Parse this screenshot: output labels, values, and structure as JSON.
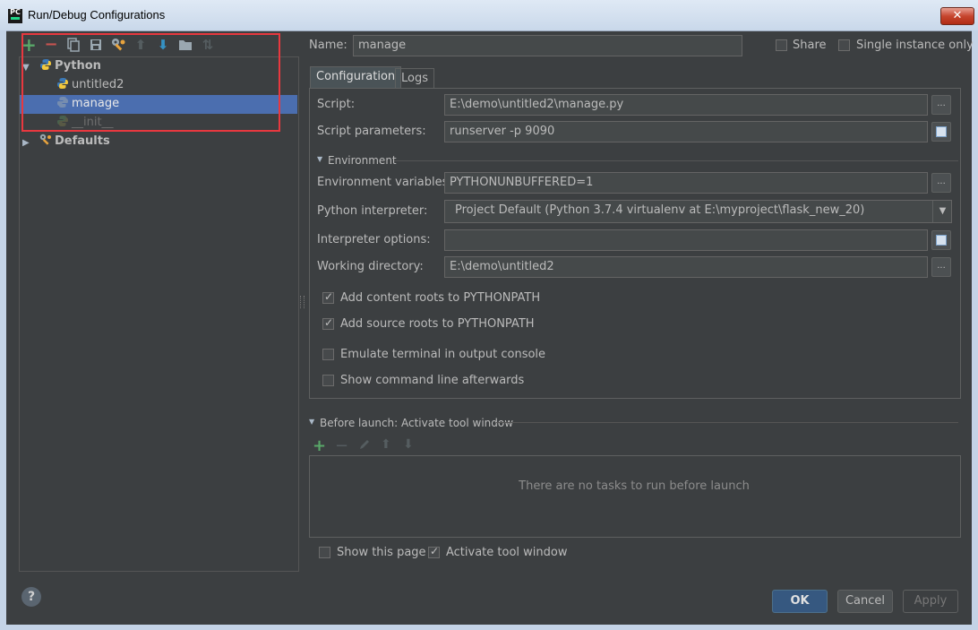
{
  "window": {
    "title": "Run/Debug Configurations",
    "close_glyph": "✕",
    "app_icon_text": "PC"
  },
  "toolbar": {
    "icons": [
      "add-icon",
      "remove-icon",
      "copy-icon",
      "save-icon",
      "wrench-icon",
      "move-up-icon",
      "move-down-icon",
      "folder-icon",
      "sort-icon"
    ],
    "glyphs": {
      "add": "+",
      "remove": "−",
      "up": "⬆",
      "down": "⬇",
      "sort": "⇅"
    }
  },
  "tree": {
    "python_group": "Python",
    "items": [
      "untitled2",
      "manage",
      "__init__"
    ],
    "selected": "manage",
    "defaults": "Defaults"
  },
  "form": {
    "name_label": "Name:",
    "name_value": "manage",
    "share_label": "Share",
    "single_instance_label": "Single instance only",
    "tabs": [
      "Configuration",
      "Logs"
    ],
    "active_tab": "Configuration",
    "script_label": "Script:",
    "script_value": "E:\\demo\\untitled2\\manage.py",
    "script_params_label": "Script parameters:",
    "script_params_value": "runserver -p 9090",
    "environment_header": "Environment",
    "env_vars_label": "Environment variables:",
    "env_vars_value": "PYTHONUNBUFFERED=1",
    "interpreter_label": "Python interpreter:",
    "interpreter_value": "Project Default (Python 3.7.4 virtualenv at E:\\myproject\\flask_new_20)",
    "interp_options_label": "Interpreter options:",
    "interp_options_value": "",
    "workdir_label": "Working directory:",
    "workdir_value": "E:\\demo\\untitled2",
    "dots": "...",
    "checkboxes": [
      {
        "label": "Add content roots to PYTHONPATH",
        "checked": true
      },
      {
        "label": "Add source roots to PYTHONPATH",
        "checked": true
      },
      {
        "label": "Emulate terminal in output console",
        "checked": false
      },
      {
        "label": "Show command line afterwards",
        "checked": false
      }
    ]
  },
  "before_launch": {
    "header": "Before launch: Activate tool window",
    "empty_text": "There are no tasks to run before launch",
    "show_page_label": "Show this page",
    "activate_label": "Activate tool window"
  },
  "buttons": {
    "ok": "OK",
    "cancel": "Cancel",
    "apply": "Apply",
    "help": "?"
  },
  "colors": {
    "accent": "#4b6eaf",
    "background": "#3c3f41",
    "annotation": "#e8383f",
    "add_green": "#59a869",
    "remove_red": "#c75450",
    "blue_arrow": "#3592c4"
  }
}
